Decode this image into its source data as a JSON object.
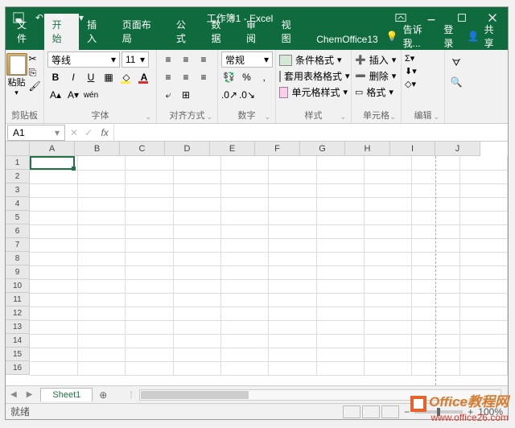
{
  "title": "工作簿1 - Excel",
  "tabs": {
    "file": "文件",
    "home": "开始",
    "insert": "插入",
    "layout": "页面布局",
    "formula": "公式",
    "data": "数据",
    "review": "审阅",
    "view": "视图",
    "chem": "ChemOffice13"
  },
  "tell": "告诉我...",
  "login": "登录",
  "share": "共享",
  "ribbon": {
    "clipboard": {
      "paste": "粘贴",
      "label": "剪贴板"
    },
    "font": {
      "name": "等线",
      "size": "11",
      "label": "字体"
    },
    "align": {
      "label": "对齐方式"
    },
    "number": {
      "fmt": "常规",
      "label": "数字"
    },
    "styles": {
      "cond": "条件格式",
      "tbl": "套用表格格式",
      "cell": "单元格样式",
      "label": "样式"
    },
    "cells": {
      "ins": "插入",
      "del": "删除",
      "fmt": "格式",
      "label": "单元格"
    },
    "edit": {
      "label": "编辑"
    }
  },
  "namebox": "A1",
  "cols": [
    "A",
    "B",
    "C",
    "D",
    "E",
    "F",
    "G",
    "H",
    "I",
    "J"
  ],
  "rows": [
    "1",
    "2",
    "3",
    "4",
    "5",
    "6",
    "7",
    "8",
    "9",
    "10",
    "11",
    "12",
    "13",
    "14",
    "15",
    "16"
  ],
  "sheet": "Sheet1",
  "status": "就绪",
  "zoom": "100%",
  "wm": {
    "t1": "Office教程网",
    "t2": "www.office26.com"
  }
}
